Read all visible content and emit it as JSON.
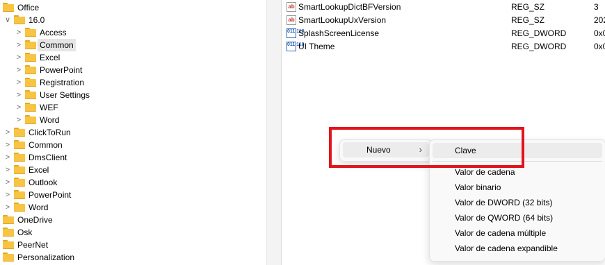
{
  "tree": {
    "items": [
      {
        "label": "Office",
        "chevron": ""
      },
      {
        "label": "16.0",
        "chevron": "∨"
      },
      {
        "label": "Access",
        "chevron": ">"
      },
      {
        "label": "Common",
        "chevron": ">"
      },
      {
        "label": "Excel",
        "chevron": ">"
      },
      {
        "label": "PowerPoint",
        "chevron": ">"
      },
      {
        "label": "Registration",
        "chevron": ">"
      },
      {
        "label": "User Settings",
        "chevron": ">"
      },
      {
        "label": "WEF",
        "chevron": ">"
      },
      {
        "label": "Word",
        "chevron": ">"
      },
      {
        "label": "ClickToRun",
        "chevron": ">"
      },
      {
        "label": "Common",
        "chevron": ">"
      },
      {
        "label": "DmsClient",
        "chevron": ">"
      },
      {
        "label": "Excel",
        "chevron": ">"
      },
      {
        "label": "Outlook",
        "chevron": ">"
      },
      {
        "label": "PowerPoint",
        "chevron": ">"
      },
      {
        "label": "Word",
        "chevron": ">"
      },
      {
        "label": "OneDrive",
        "chevron": ""
      },
      {
        "label": "Osk",
        "chevron": ""
      },
      {
        "label": "PeerNet",
        "chevron": ""
      },
      {
        "label": "Personalization",
        "chevron": ""
      }
    ],
    "selected_index": 3
  },
  "values": {
    "rows": [
      {
        "name": "SmartLookupDictBFVersion",
        "type": "REG_SZ",
        "data": "3",
        "icon": "string-value-icon",
        "icon_text": "ab"
      },
      {
        "name": "SmartLookupUxVersion",
        "type": "REG_SZ",
        "data": "202",
        "icon": "string-value-icon",
        "icon_text": "ab"
      },
      {
        "name": "SplashScreenLicense",
        "type": "REG_DWORD",
        "data": "0x0",
        "icon": "binary-value-icon",
        "icon_text": "011 110"
      },
      {
        "name": "UI Theme",
        "type": "REG_DWORD",
        "data": "0x0",
        "icon": "binary-value-icon",
        "icon_text": "011 110"
      }
    ]
  },
  "context_menu": {
    "new_label": "Nuevo",
    "new_arrow": "›"
  },
  "submenu": {
    "items": [
      "Clave",
      "Valor de cadena",
      "Valor binario",
      "Valor de DWORD (32 bits)",
      "Valor de QWORD (64 bits)",
      "Valor de cadena múltiple",
      "Valor de cadena expandible"
    ]
  },
  "colors": {
    "highlight_box": "#e2141e",
    "folder": "#f7c443",
    "selection": "#e5e5e5"
  }
}
